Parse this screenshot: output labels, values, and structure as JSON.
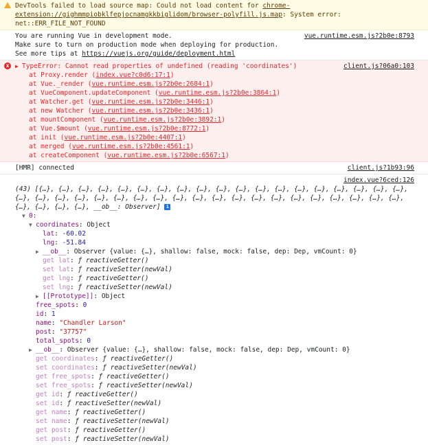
{
  "warning": {
    "text": "DevTools failed to load source map: Could not load content for ",
    "url": "chrome-extension://gighmmpiobklfepjocnamgkkbiglidom/browser-polyfill.js.map",
    "suffix": ": System error: net::ERR_FILE_NOT_FOUND"
  },
  "info_vue": {
    "line1": "You are running Vue in development mode.",
    "line2": "Make sure to turn on production mode when deploying for production.",
    "line3_prefix": "See more tips at ",
    "line3_link": "https://vuejs.org/guide/deployment.html",
    "source": "vue.runtime.esm.js?2b0e:8793"
  },
  "error": {
    "icon": "x",
    "title": "TypeError: Cannot read properties of undefined (reading 'coordinates')",
    "source": "client.js?06a0:103",
    "stack": [
      {
        "at": "at Proxy.render (",
        "loc": "index.vue?c0d6:17:1",
        "end": ")"
      },
      {
        "at": "at Vue._render (",
        "loc": "vue.runtime.esm.js?2b0e:2684:1",
        "end": ")"
      },
      {
        "at": "at VueComponent.updateComponent (",
        "loc": "vue.runtime.esm.js?2b0e:3864:1",
        "end": ")"
      },
      {
        "at": "at Watcher.get (",
        "loc": "vue.runtime.esm.js?2b0e:3446:1",
        "end": ")"
      },
      {
        "at": "at new Watcher (",
        "loc": "vue.runtime.esm.js?2b0e:3436:1",
        "end": ")"
      },
      {
        "at": "at mountComponent (",
        "loc": "vue.runtime.esm.js?2b0e:3892:1",
        "end": ")"
      },
      {
        "at": "at Vue.$mount (",
        "loc": "vue.runtime.esm.js?2b0e:8772:1",
        "end": ")"
      },
      {
        "at": "at init (",
        "loc": "vue.runtime.esm.js?2b0e:4407:1",
        "end": ")"
      },
      {
        "at": "at merged (",
        "loc": "vue.runtime.esm.js?2b0e:4561:1",
        "end": ")"
      },
      {
        "at": "at createComponent (",
        "loc": "vue.runtime.esm.js?2b0e:6567:1",
        "end": ")"
      }
    ]
  },
  "hmr": {
    "text": "[HMR] connected",
    "source": "client.js?1b93:96"
  },
  "log": {
    "source": "index.vue?6ced:126",
    "array_preview": "(43) [{…}, {…}, {…}, {…}, {…}, {…}, {…}, {…}, {…}, {…}, {…}, {…}, {…}, {…}, {…}, {…}, {…}, {…}, {…}, {…}, {…}, {…}, {…}, {…}, {…}, {…}, {…}, {…}, {…}, {…}, {…}, {…}, {…}, {…}, {…}, {…}, {…}, {…}, {…}, {…}, {…}, {…}, {…}, __ob__: Observer]",
    "info_badge": "i",
    "item0_label": "0:",
    "coordinates_key": "coordinates",
    "coordinates_type": "Object",
    "lat_key": "lat",
    "lat_val": "-60.02",
    "lng_key": "lng",
    "lng_val": "-51.84",
    "ob_key": "__ob__",
    "ob_val": "Observer {value: {…}, shallow: false, mock: false, dep: Dep, vmCount: 0}",
    "coord_accessors": [
      {
        "k": "get lat",
        "f": "ƒ",
        "fn": "reactiveGetter()"
      },
      {
        "k": "set lat",
        "f": "ƒ",
        "fn": "reactiveSetter(newVal)"
      },
      {
        "k": "get lng",
        "f": "ƒ",
        "fn": "reactiveGetter()"
      },
      {
        "k": "set lng",
        "f": "ƒ",
        "fn": "reactiveSetter(newVal)"
      }
    ],
    "prototype_key": "[[Prototype]]",
    "prototype_val": "Object",
    "fields": [
      {
        "k": "free_spots",
        "v": "0",
        "t": "num"
      },
      {
        "k": "id",
        "v": "1",
        "t": "num"
      },
      {
        "k": "name",
        "v": "\"Chandler Larson\"",
        "t": "str"
      },
      {
        "k": "post",
        "v": "\"37757\"",
        "t": "str"
      },
      {
        "k": "total_spots",
        "v": "0",
        "t": "num"
      }
    ],
    "item_ob_key": "__ob__",
    "item_ob_val": "Observer {value: {…}, shallow: false, mock: false, dep: Dep, vmCount: 0}",
    "item_accessors": [
      {
        "k": "get coordinates",
        "f": "ƒ",
        "fn": "reactiveGetter()"
      },
      {
        "k": "set coordinates",
        "f": "ƒ",
        "fn": "reactiveSetter(newVal)"
      },
      {
        "k": "get free_spots",
        "f": "ƒ",
        "fn": "reactiveGetter()"
      },
      {
        "k": "set free_spots",
        "f": "ƒ",
        "fn": "reactiveSetter(newVal)"
      },
      {
        "k": "get id",
        "f": "ƒ",
        "fn": "reactiveGetter()"
      },
      {
        "k": "set id",
        "f": "ƒ",
        "fn": "reactiveSetter(newVal)"
      },
      {
        "k": "get name",
        "f": "ƒ",
        "fn": "reactiveGetter()"
      },
      {
        "k": "set name",
        "f": "ƒ",
        "fn": "reactiveSetter(newVal)"
      },
      {
        "k": "get post",
        "f": "ƒ",
        "fn": "reactiveGetter()"
      },
      {
        "k": "set post",
        "f": "ƒ",
        "fn": "reactiveSetter(newVal)"
      }
    ]
  }
}
